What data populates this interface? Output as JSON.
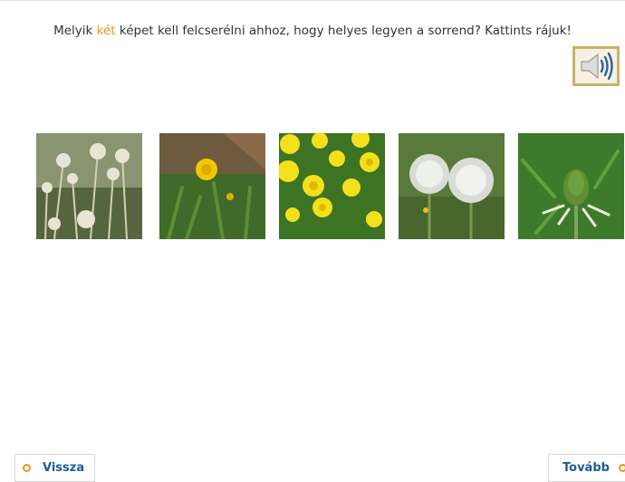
{
  "instruction": {
    "before": "Melyik ",
    "highlight": "két",
    "after": " képet kell felcserélni ahhoz, hogy helyes legyen a sorrend? Kattints rájuk!"
  },
  "sound_button": {
    "icon": "speaker-icon"
  },
  "photos": [
    {
      "icon": "dandelion-seed-stems-icon"
    },
    {
      "icon": "dandelion-bud-opening-icon"
    },
    {
      "icon": "dandelion-flowers-icon"
    },
    {
      "icon": "dandelion-seed-heads-icon"
    },
    {
      "icon": "dandelion-closed-head-icon"
    }
  ],
  "navigation": {
    "back_label": "Vissza",
    "next_label": "Tovább"
  },
  "colors": {
    "highlight": "#f0941e",
    "button_text": "#1c5d96",
    "sound_border": "#c9b36a"
  }
}
